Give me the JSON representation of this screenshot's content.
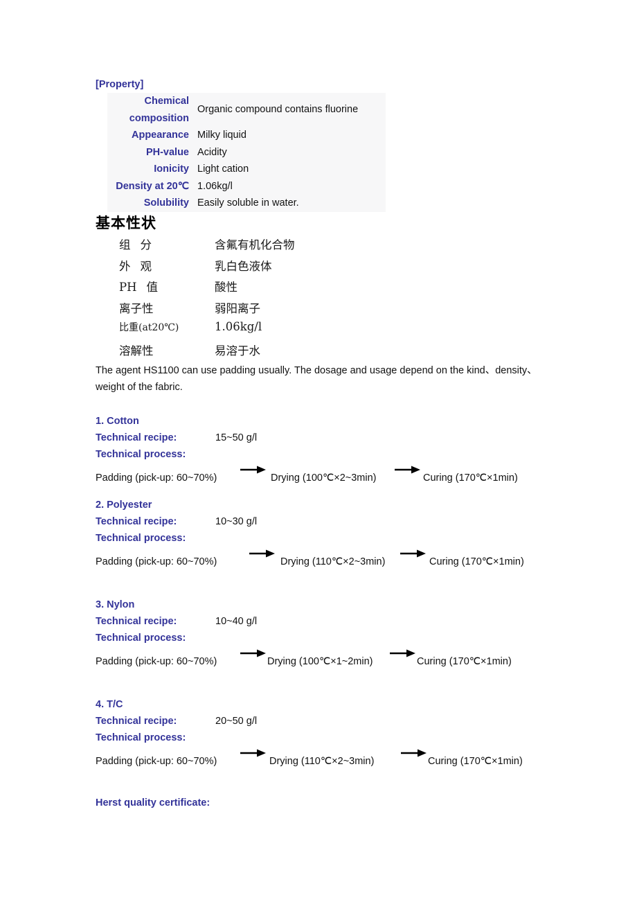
{
  "document": {
    "property_heading": "[Property]",
    "chinese_heading": "基本性状",
    "intro_paragraph": "The agent HS1100 can use padding usually. The dosage and usage depend on the kind、density、weight of the fabric.",
    "footer_note": "Herst quality certificate:",
    "colors": {
      "heading_blue": "#333399",
      "body_black": "#111111",
      "table_background": "#f7f7f8"
    }
  },
  "property_table": {
    "rows": [
      {
        "label": "Chemical composition",
        "label_line1": "Chemical",
        "label_line2": "composition",
        "value": "Organic compound contains fluorine"
      },
      {
        "label": "Appearance",
        "value": "Milky liquid"
      },
      {
        "label": "PH-value",
        "value": "Acidity"
      },
      {
        "label": "Ionicity",
        "value": "Light cation"
      },
      {
        "label": "Density at 20℃",
        "value": "1.06kg/l"
      },
      {
        "label": "Solubility",
        "value": "Easily soluble in water."
      }
    ]
  },
  "chinese_list": {
    "rows": [
      {
        "label": "组 分",
        "label_a": "组",
        "label_b": "分",
        "value": "含氟有机化合物"
      },
      {
        "label": "外 观",
        "label_a": "外",
        "label_b": "观",
        "value": "乳白色液体"
      },
      {
        "label": "PH 值",
        "label_a": "PH",
        "label_b": "值",
        "value": "酸性"
      },
      {
        "label": "离子性",
        "label_a": "离子性",
        "label_b": "",
        "value": "弱阳离子"
      },
      {
        "label": "比重(at20℃)",
        "label_a": "比重(at20℃)",
        "label_b": "",
        "value": "1.06kg/l"
      },
      {
        "label": "溶解性",
        "label_a": "溶解性",
        "label_b": "",
        "value": "易溶于水"
      }
    ]
  },
  "sections": [
    {
      "title": "1. Cotton",
      "recipe_label": "Technical recipe:",
      "recipe_value": "15~50 g/l",
      "process_label": "Technical process:",
      "flow": {
        "step1": "Padding (pick-up: 60~70%)",
        "step2": "Drying (100℃×2~3min)",
        "step3": "Curing (170℃×1min)"
      }
    },
    {
      "title": "2. Polyester",
      "recipe_label": "Technical recipe:",
      "recipe_value": "10~30 g/l",
      "process_label": "Technical process:",
      "flow": {
        "step1": "Padding (pick-up: 60~70%)",
        "step2": "Drying (110℃×2~3min)",
        "step3": "Curing (170℃×1min)"
      }
    },
    {
      "title": "3. Nylon",
      "recipe_label": "Technical recipe:",
      "recipe_value": "10~40 g/l",
      "process_label": "Technical process:",
      "flow": {
        "step1": "Padding (pick-up: 60~70%)",
        "step2": "Drying (100℃×1~2min)",
        "step3": "Curing (170℃×1min)"
      }
    },
    {
      "title": "4. T/C",
      "recipe_label": "Technical recipe:",
      "recipe_value": "20~50 g/l",
      "process_label": "Technical process:",
      "flow": {
        "step1": "Padding (pick-up: 60~70%)",
        "step2": "Drying (110℃×2~3min)",
        "step3": "Curing (170℃×1min)"
      }
    }
  ]
}
